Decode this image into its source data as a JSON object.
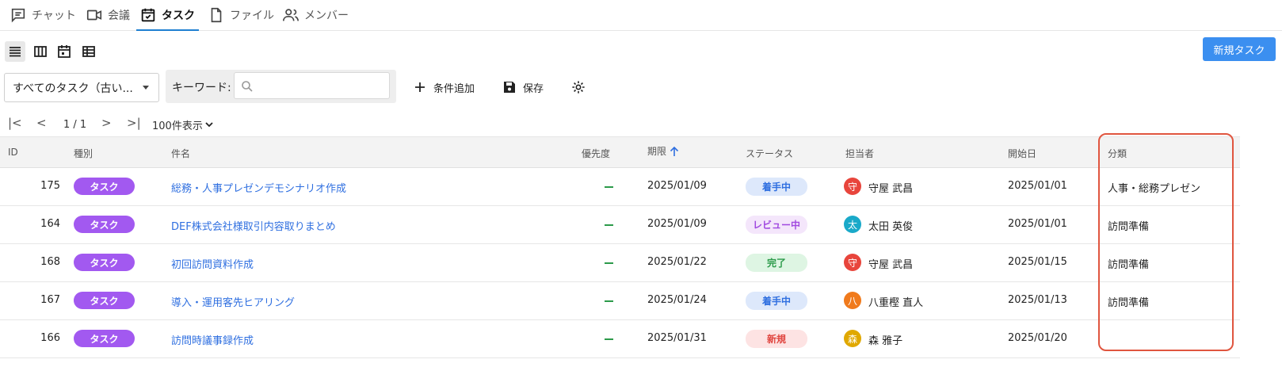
{
  "tabs": [
    {
      "label": "チャット"
    },
    {
      "label": "会議"
    },
    {
      "label": "タスク"
    },
    {
      "label": "ファイル"
    },
    {
      "label": "メンバー"
    }
  ],
  "toolbar": {
    "new_task_label": "新規タスク",
    "filter_select_value": "すべてのタスク（古い...",
    "keyword_label": "キーワード:",
    "keyword_value": "",
    "add_condition_label": "条件追加",
    "save_label": "保存"
  },
  "pagination": {
    "page_info": "1 / 1",
    "page_size_label": "100件表示"
  },
  "columns": {
    "id": "ID",
    "type": "種別",
    "subject": "件名",
    "priority": "優先度",
    "due": "期限",
    "status": "ステータス",
    "assignee": "担当者",
    "start": "開始日",
    "category": "分類"
  },
  "rows": [
    {
      "id": "175",
      "type": "タスク",
      "subject": "総務・人事プレゼンデモシナリオ作成",
      "due": "2025/01/09",
      "status": "着手中",
      "avatar": "守",
      "assignee": "守屋 武昌",
      "start": "2025/01/01",
      "category": "人事・総務プレゼン"
    },
    {
      "id": "164",
      "type": "タスク",
      "subject": "DEF株式会社様取引内容取りまとめ",
      "due": "2025/01/09",
      "status": "レビュー中",
      "avatar": "太",
      "assignee": "太田 英俊",
      "start": "2025/01/01",
      "category": "訪問準備"
    },
    {
      "id": "168",
      "type": "タスク",
      "subject": "初回訪問資料作成",
      "due": "2025/01/22",
      "status": "完了",
      "avatar": "守",
      "assignee": "守屋 武昌",
      "start": "2025/01/15",
      "category": "訪問準備"
    },
    {
      "id": "167",
      "type": "タスク",
      "subject": "導入・運用客先ヒアリング",
      "due": "2025/01/24",
      "status": "着手中",
      "avatar": "八",
      "assignee": "八重樫 直人",
      "start": "2025/01/13",
      "category": "訪問準備"
    },
    {
      "id": "166",
      "type": "タスク",
      "subject": "訪問時議事録作成",
      "due": "2025/01/31",
      "status": "新規",
      "avatar": "森",
      "assignee": "森 雅子",
      "start": "2025/01/20",
      "category": ""
    }
  ],
  "colors": {
    "accent": "#1f7fd1",
    "primary_button": "#3b8ff0",
    "type_badge": "#a259f0",
    "status_in_progress_bg": "#dde8fb",
    "status_in_progress_fg": "#2f6fe0",
    "status_review_bg": "#f4e6fb",
    "status_review_fg": "#a14ae0",
    "status_done_bg": "#def5e3",
    "status_done_fg": "#2c9a4a",
    "status_new_bg": "#fde3e3",
    "status_new_fg": "#e0453f",
    "avatar_mori_ya": "#e8453c",
    "avatar_ota": "#1aa9c9",
    "avatar_yaegashi": "#f07a1c",
    "avatar_mori": "#e0a800",
    "highlight": "#e0553f"
  }
}
